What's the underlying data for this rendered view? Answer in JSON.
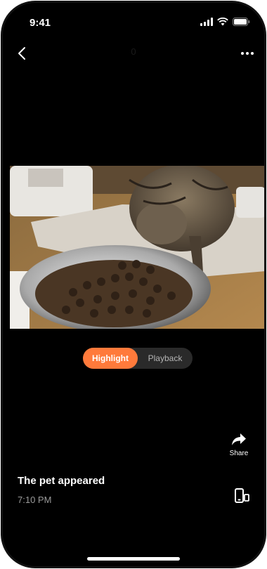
{
  "status_bar": {
    "time": "9:41"
  },
  "nav": {
    "title": "0"
  },
  "toggle": {
    "highlight_label": "Highlight",
    "playback_label": "Playback",
    "selected": "Highlight"
  },
  "share": {
    "label": "Share"
  },
  "event": {
    "title": "The pet appeared",
    "time": "7:10 PM"
  },
  "colors": {
    "accent": "#ff7a3b",
    "background": "#000000",
    "muted": "#9a9a9a"
  }
}
